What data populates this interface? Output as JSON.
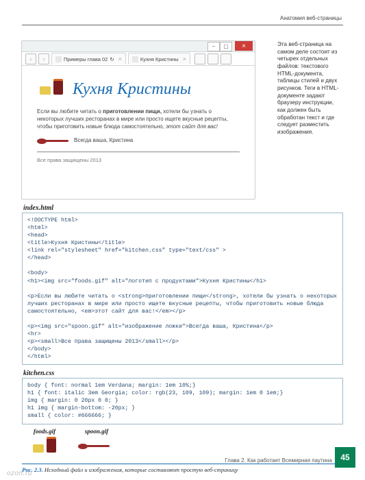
{
  "running_head": "Анатомия веб-страницы",
  "side_note": "Эта веб-страница на самом деле состоит из четырех отдельных файлов: текстового HTML-документа, таблицы стилей и двух рисунков. Теги в HTML-документе задают браузеру инструкции, как должен быть обработан текст и где следует разместить изображения.",
  "browser": {
    "tab1": "Примеры глава 02",
    "tab2": "Кухня Кристины",
    "close": "×"
  },
  "webpage": {
    "title": "Кухня Кристины",
    "para": "Если вы любите читать о приготовлении пищи, хотели бы узнать о некоторых лучших ресторанах в мире или просто ищете вкусные рецепты, чтобы приготовить новые блюда самостоятельно, этот сайт для вас!",
    "sign": "Всегда ваша, Кристина",
    "copy": "Все права защищены 2013"
  },
  "file1_label": "index.html",
  "file1_code": "<!DOCTYPE html>\n<html>\n<head>\n<title>Кухня Кристины</title>\n<link rel=\"stylesheet\" href=\"kitchen.css\" type=\"text/css\" >\n</head>\n\n<body>\n<h1><img src=\"foods.gif\" alt=\"логотип с продуктами\">Кухня Кристины</h1>\n\n<p>Если вы любите читать о <strong>приготовлении пищи</strong>, хотели бы узнать о некоторых лучших ресторанах в мире или просто ищете вкусные рецепты, чтобы приготовить новые блюда самостоятельно, <em>этот сайт для вас!</em></p>\n\n<p><img src=\"spoon.gif\" alt=\"изображение ложки\">Всегда ваша, Кристина</p>\n<hr>\n<p><small>Все права защищены 2013</small></p>\n</body>\n</html>",
  "file2_label": "kitchen.css",
  "file2_code": "body { font: normal 1em Verdana; margin: 1em 10%;}\nh1 { font: italic 3em Georgia; color: rgb(23, 109, 109); margin: 1em 0 1em;}\nimg { margin: 0 20px 0 0; }\nh1 img { margin-bottom: -20px; }\nsmall { color: #666666; }",
  "img1_label": "foods.gif",
  "img2_label": "spoon.gif",
  "caption_prefix": "Рис. 2.3.",
  "caption_text": " Исходный файл и изображения, которые составляют простую веб-страницу",
  "chapter_footer": "Глава 2. Как работает Всемирная паутина",
  "page_number": "45",
  "watermark": "ozon.ru"
}
